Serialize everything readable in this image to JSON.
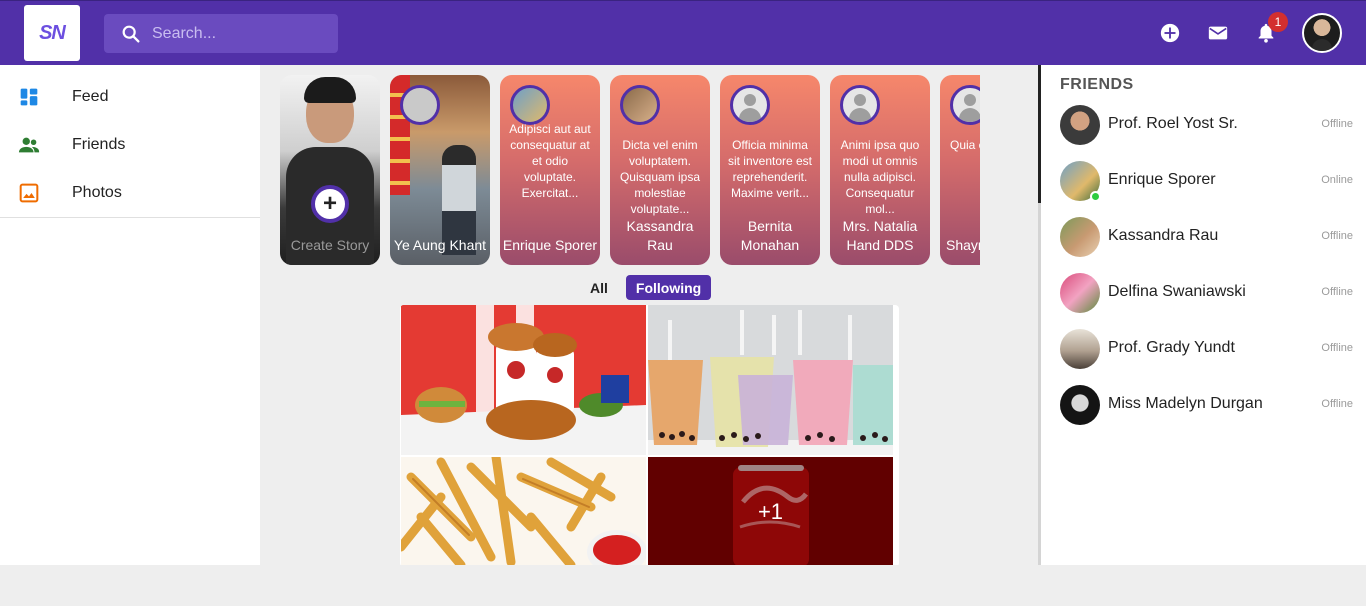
{
  "brand": {
    "logo_text": "SN",
    "accent": "#5130a8"
  },
  "search": {
    "placeholder": "Search..."
  },
  "header": {
    "icons": [
      "add-circle-icon",
      "mail-icon",
      "bell-icon"
    ],
    "notification_count": "1"
  },
  "sidebar": {
    "items": [
      {
        "label": "Feed",
        "icon": "dashboard-icon",
        "color": "#1e88e5"
      },
      {
        "label": "Friends",
        "icon": "people-icon",
        "color": "#2e7d32"
      },
      {
        "label": "Photos",
        "icon": "photo-icon",
        "color": "#ef6c00"
      }
    ]
  },
  "stories": [
    {
      "name": "Create Story",
      "text": ""
    },
    {
      "name": "Ye Aung Khant",
      "text": ""
    },
    {
      "name": "Enrique Sporer",
      "text": "Adipisci aut aut consequatur at et odio voluptate. Exercitat..."
    },
    {
      "name": "Kassandra Rau",
      "text": "Dicta vel enim voluptatem. Quisquam ipsa molestiae voluptate..."
    },
    {
      "name": "Bernita Monahan",
      "text": "Officia minima sit inventore est reprehenderit. Maxime verit..."
    },
    {
      "name": "Mrs. Natalia Hand DDS",
      "text": "Animi ipsa quo modi ut omnis nulla adipisci. Consequatur mol..."
    },
    {
      "name": "Shayn",
      "text": "Quia e volup moles M"
    }
  ],
  "feed_filters": {
    "all": "All",
    "following": "Following"
  },
  "post": {
    "more_count": "+1"
  },
  "friends": {
    "title": "FRIENDS",
    "list": [
      {
        "name": "Prof. Roel Yost Sr.",
        "status": "Offline",
        "online": false
      },
      {
        "name": "Enrique Sporer",
        "status": "Online",
        "online": true
      },
      {
        "name": "Kassandra Rau",
        "status": "Offline",
        "online": false
      },
      {
        "name": "Delfina Swaniawski",
        "status": "Offline",
        "online": false
      },
      {
        "name": "Prof. Grady Yundt",
        "status": "Offline",
        "online": false
      },
      {
        "name": "Miss Madelyn Durgan",
        "status": "Offline",
        "online": false
      }
    ]
  }
}
